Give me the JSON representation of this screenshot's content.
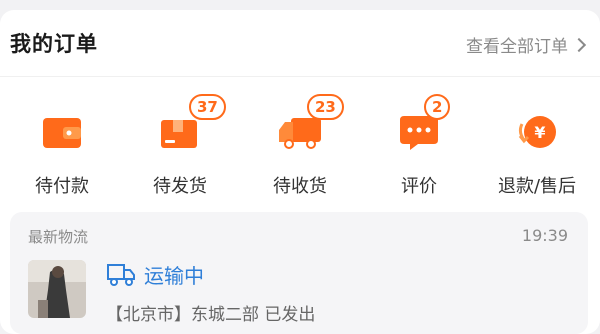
{
  "header": {
    "title": "我的订单",
    "view_all": "查看全部订单"
  },
  "order_tabs": [
    {
      "label": "待付款",
      "icon": "wallet-icon",
      "badge": ""
    },
    {
      "label": "待发货",
      "icon": "package-icon",
      "badge": "37"
    },
    {
      "label": "待收货",
      "icon": "truck-icon",
      "badge": "23"
    },
    {
      "label": "评价",
      "icon": "comment-icon",
      "badge": "2"
    },
    {
      "label": "退款/售后",
      "icon": "refund-icon",
      "badge": ""
    }
  ],
  "logistics": {
    "label": "最新物流",
    "time": "19:39",
    "status": "运输中",
    "detail": "【北京市】东城二部 已发出",
    "status_icon": "delivery-truck-icon"
  },
  "colors": {
    "accent": "#ff6a1a",
    "status_blue": "#2f7fd8"
  }
}
